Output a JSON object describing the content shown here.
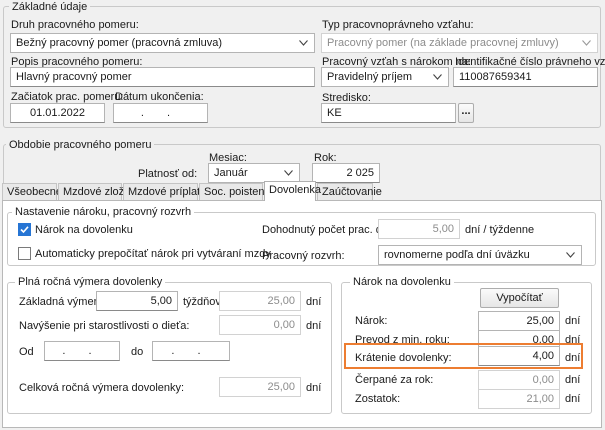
{
  "zakladne": {
    "legend": "Základné údaje",
    "druh_label": "Druh pracovného pomeru:",
    "druh_value": "Bežný pracovný pomer (pracovná zmluva)",
    "typ_label": "Typ pracovnoprávneho vzťahu:",
    "typ_value": "Pracovný pomer (na základe pracovnej zmluvy)",
    "popis_label": "Popis pracovného pomeru:",
    "popis_value": "Hlavný pracovný pomer",
    "pracovny_vztah_label": "Pracovný vzťah s nárokom na:",
    "pracovny_vztah_value": "Pravidelný príjem",
    "identifikacne_label": "Identifikačné číslo právneho vzťahu:",
    "identifikacne_value": "110087659341",
    "zaciatok_label": "Začiatok prac. pomeru:",
    "zaciatok_value": "01.01.2022",
    "datum_ukoncenia_label": "Dátum ukončenia:",
    "datum_ukoncenia_value": ". .",
    "stredisko_label": "Stredisko:",
    "stredisko_value": "KE",
    "stredisko_browse": "..."
  },
  "obdobie": {
    "legend": "Obdobie pracovného pomeru",
    "platnost_label": "Platnosť od:",
    "mesiac_label": "Mesiac:",
    "mesiac_value": "Január",
    "rok_label": "Rok:",
    "rok_value": "2 025"
  },
  "tabs": [
    {
      "label": "Všeobecné",
      "active": false
    },
    {
      "label": "Mzdové zložky",
      "active": false
    },
    {
      "label": "Mzdové príplatky",
      "active": false
    },
    {
      "label": "Soc. poistenie",
      "active": false
    },
    {
      "label": "Dovolenka",
      "active": true
    },
    {
      "label": "Zaúčtovanie",
      "active": false
    }
  ],
  "nastavenie": {
    "legend": "Nastavenie nároku, pracovný rozvrh",
    "narok_checkbox_label": "Nárok na dovolenku",
    "narok_checked": true,
    "auto_checkbox_label": "Automaticky prepočítať nárok pri vytváraní mzdy",
    "auto_checked": false,
    "dohodnuty_label": "Dohodnutý počet prac. dní:",
    "dohodnuty_value": "5,00",
    "dohodnuty_unit": "dní / týždenne",
    "rozvrh_label": "Pracovný rozvrh:",
    "rozvrh_value": "rovnomerne podľa dní úväzku"
  },
  "plna": {
    "legend": "Plná ročná výmera dovolenky",
    "zakladna_label": "Základná výmera:",
    "zakladna_weeks": "5,00",
    "zakladna_weeks_unit": "týždňov",
    "zakladna_days": "25,00",
    "zakladna_days_unit": "dní",
    "navysenie_label": "Navýšenie pri starostlivosti o dieťa:",
    "navysenie_value": "0,00",
    "navysenie_unit": "dní",
    "od_label": "Od",
    "od_value": ". .",
    "do_label": "do",
    "do_value": ". .",
    "celkova_label": "Celková ročná výmera dovolenky:",
    "celkova_value": "25,00",
    "celkova_unit": "dní"
  },
  "narok": {
    "legend": "Nárok na dovolenku",
    "vypocitat": "Vypočítať",
    "narok_label": "Nárok:",
    "narok_value": "25,00",
    "prevod_label": "Prevod z min. roku:",
    "prevod_value": "0,00",
    "kratenie_label": "Krátenie dovolenky:",
    "kratenie_value": "4,00",
    "cerpane_label": "Čerpané za rok:",
    "cerpane_value": "0,00",
    "zostatok_label": "Zostatok:",
    "zostatok_value": "21,00",
    "unit": "dní"
  },
  "colors": {
    "highlight": "#ed7d31",
    "checkbox_checked": "#2675d4"
  }
}
